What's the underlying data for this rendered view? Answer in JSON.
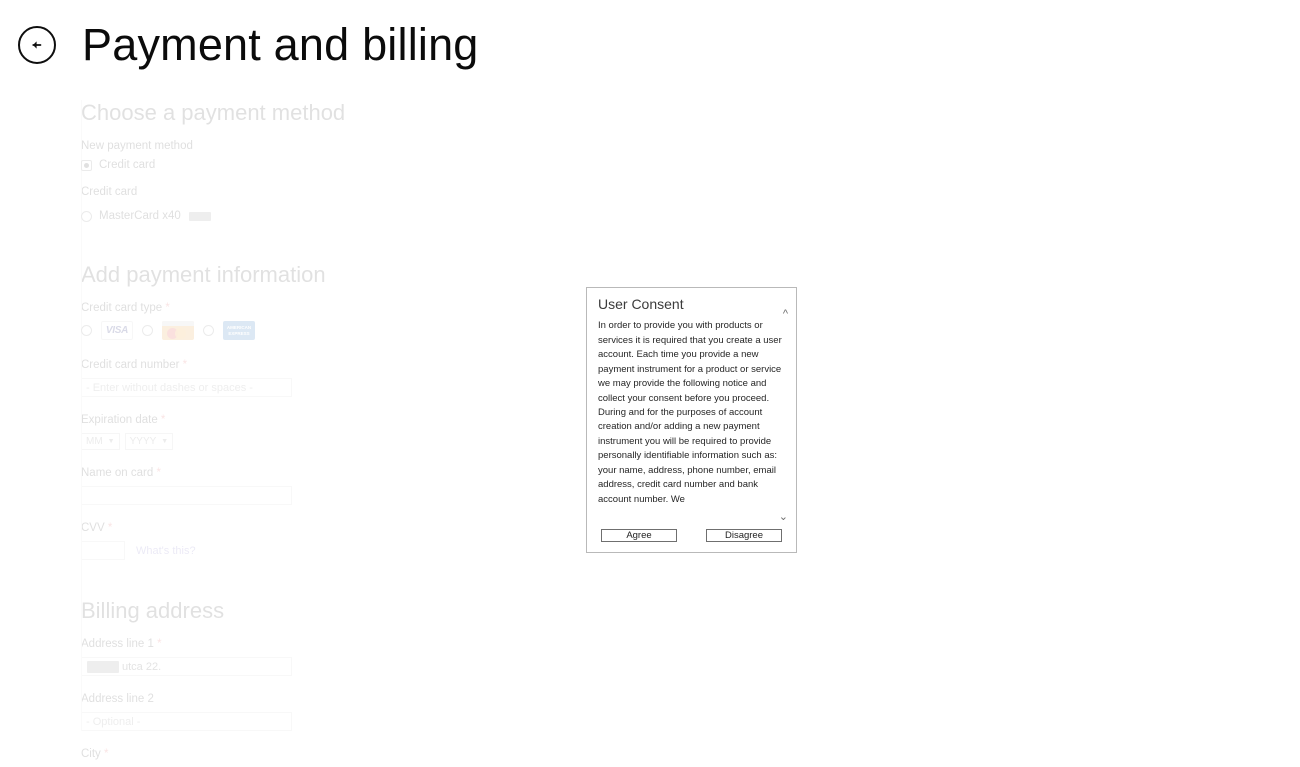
{
  "header": {
    "back_icon": "back-arrow-circle-icon",
    "title": "Payment and billing"
  },
  "form": {
    "choose_method": {
      "section_title": "Choose a payment method",
      "new_method_label": "New payment method",
      "options": [
        {
          "label": "Credit card",
          "checked": true
        }
      ],
      "saved_label": "Credit card",
      "saved_cards": [
        {
          "label": "MasterCard x40",
          "redacted": true,
          "checked": false
        }
      ]
    },
    "add_payment": {
      "section_title": "Add payment information",
      "card_type_label": "Credit card type",
      "card_types": [
        {
          "name": "visa",
          "label": "VISA",
          "checked": false
        },
        {
          "name": "mastercard",
          "label": "MasterCard",
          "checked": false
        },
        {
          "name": "amex",
          "label": "AMERICAN EXPRESS",
          "checked": false
        }
      ],
      "card_number_label": "Credit card number",
      "card_number_placeholder": "- Enter without dashes or spaces -",
      "card_number_value": "",
      "expiration_label": "Expiration date",
      "expiration_month": "MM",
      "expiration_year": "YYYY",
      "name_on_card_label": "Name on card",
      "name_on_card_value": "",
      "cvv_label": "CVV",
      "cvv_value": "",
      "whats_this_label": "What's this?"
    },
    "billing_address": {
      "section_title": "Billing address",
      "line1_label": "Address line 1",
      "line1_value": "utca 22.",
      "line1_redacted": true,
      "line2_label": "Address line 2",
      "line2_placeholder": "- Optional -",
      "line2_value": "",
      "city_label": "City"
    },
    "required_marker": "*"
  },
  "consent_dialog": {
    "title": "User Consent",
    "body": "In order to provide you with products or services it is required that you create a user account. Each time you provide a new payment instrument for a product or service we may provide the following notice and collect your consent before you proceed. During and for the purposes of account creation and/or adding a new payment instrument you will be required to provide personally identifiable information such as: your name, address, phone number, email address, credit card number and bank account number. We",
    "scroll_up_icon": "chevron-up-icon",
    "scroll_down_icon": "chevron-down-icon",
    "agree_label": "Agree",
    "disagree_label": "Disagree"
  },
  "colors": {
    "accent_link": "#8a7fc8",
    "required": "#e05c5c",
    "dialog_border": "#b9b9b9",
    "text": "#262626"
  }
}
